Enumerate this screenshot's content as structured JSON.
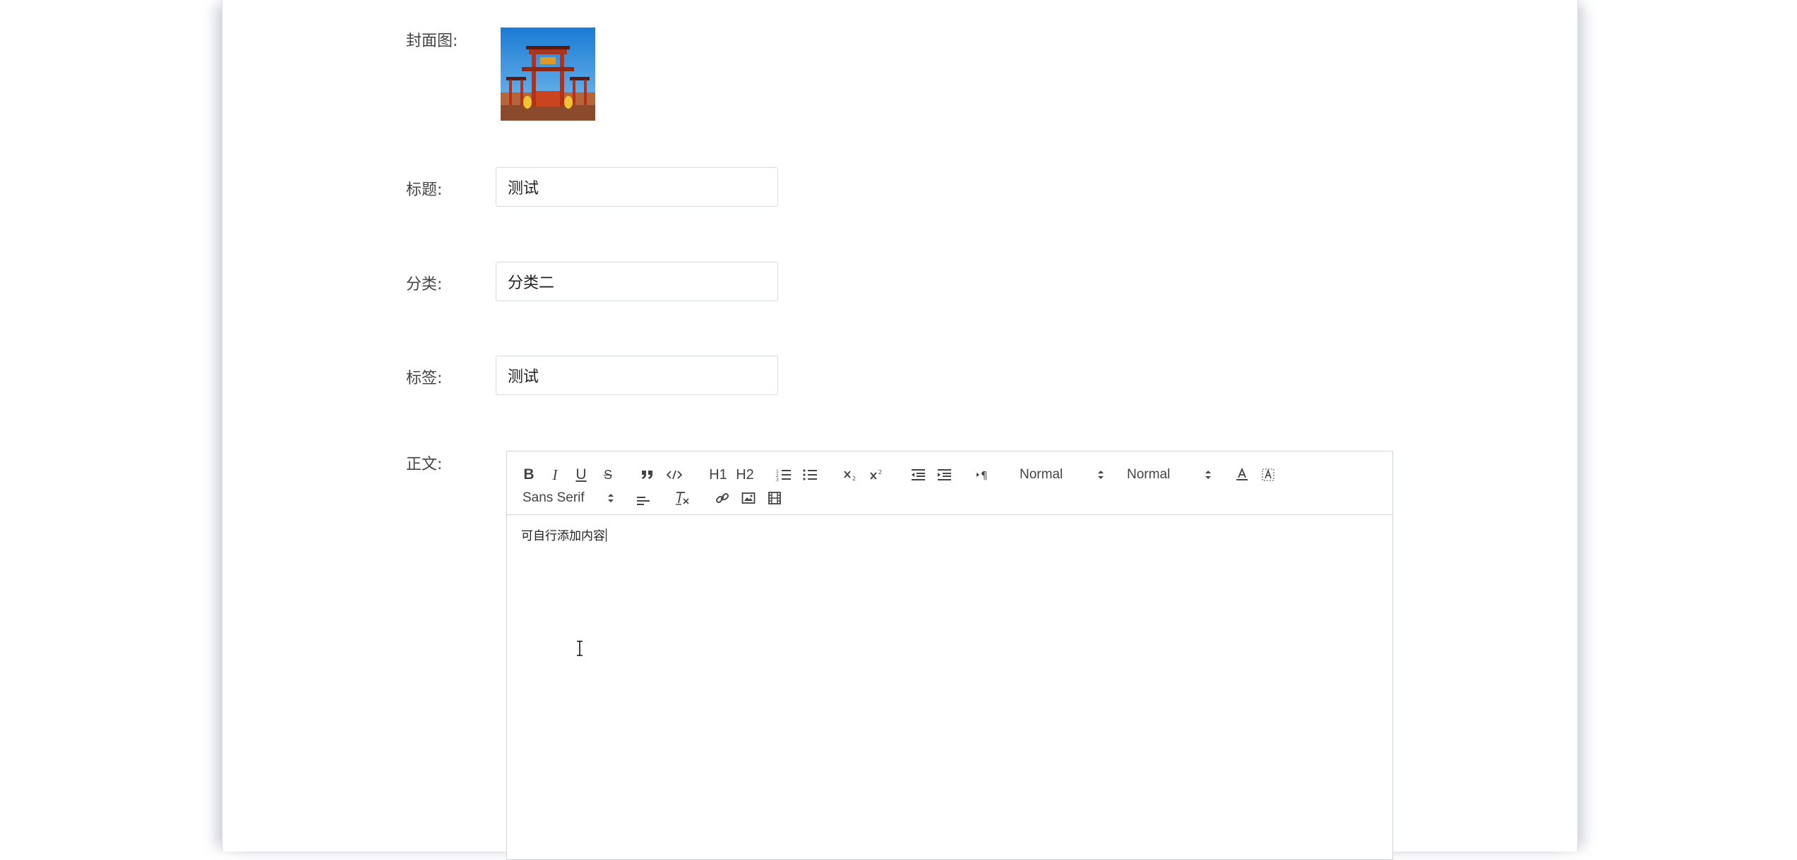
{
  "form": {
    "cover_label": "封面图:",
    "title_label": "标题:",
    "title_value": "测试",
    "category_label": "分类:",
    "category_value": "分类二",
    "tags_label": "标签:",
    "tags_value": "测试",
    "body_label": "正文:"
  },
  "editor": {
    "toolbar": {
      "bold": "B",
      "italic": "I",
      "underline": "U",
      "strike": "S",
      "h1": "H1",
      "h2": "H2",
      "header_picker": "Normal",
      "size_picker": "Normal",
      "font_picker": "Sans Serif",
      "icons": [
        "bold-icon",
        "italic-icon",
        "underline-icon",
        "strike-icon",
        "blockquote-icon",
        "code-block-icon",
        "h1-icon",
        "h2-icon",
        "ordered-list-icon",
        "bullet-list-icon",
        "subscript-icon",
        "superscript-icon",
        "outdent-icon",
        "indent-icon",
        "rtl-icon",
        "text-color-icon",
        "background-color-icon",
        "align-icon",
        "clean-format-icon",
        "link-icon",
        "image-icon",
        "video-icon"
      ]
    },
    "content": "可自行添加内容"
  },
  "colors": {
    "shadow": "#8a93aa",
    "border": "#cfd3da",
    "text": "#444444"
  }
}
